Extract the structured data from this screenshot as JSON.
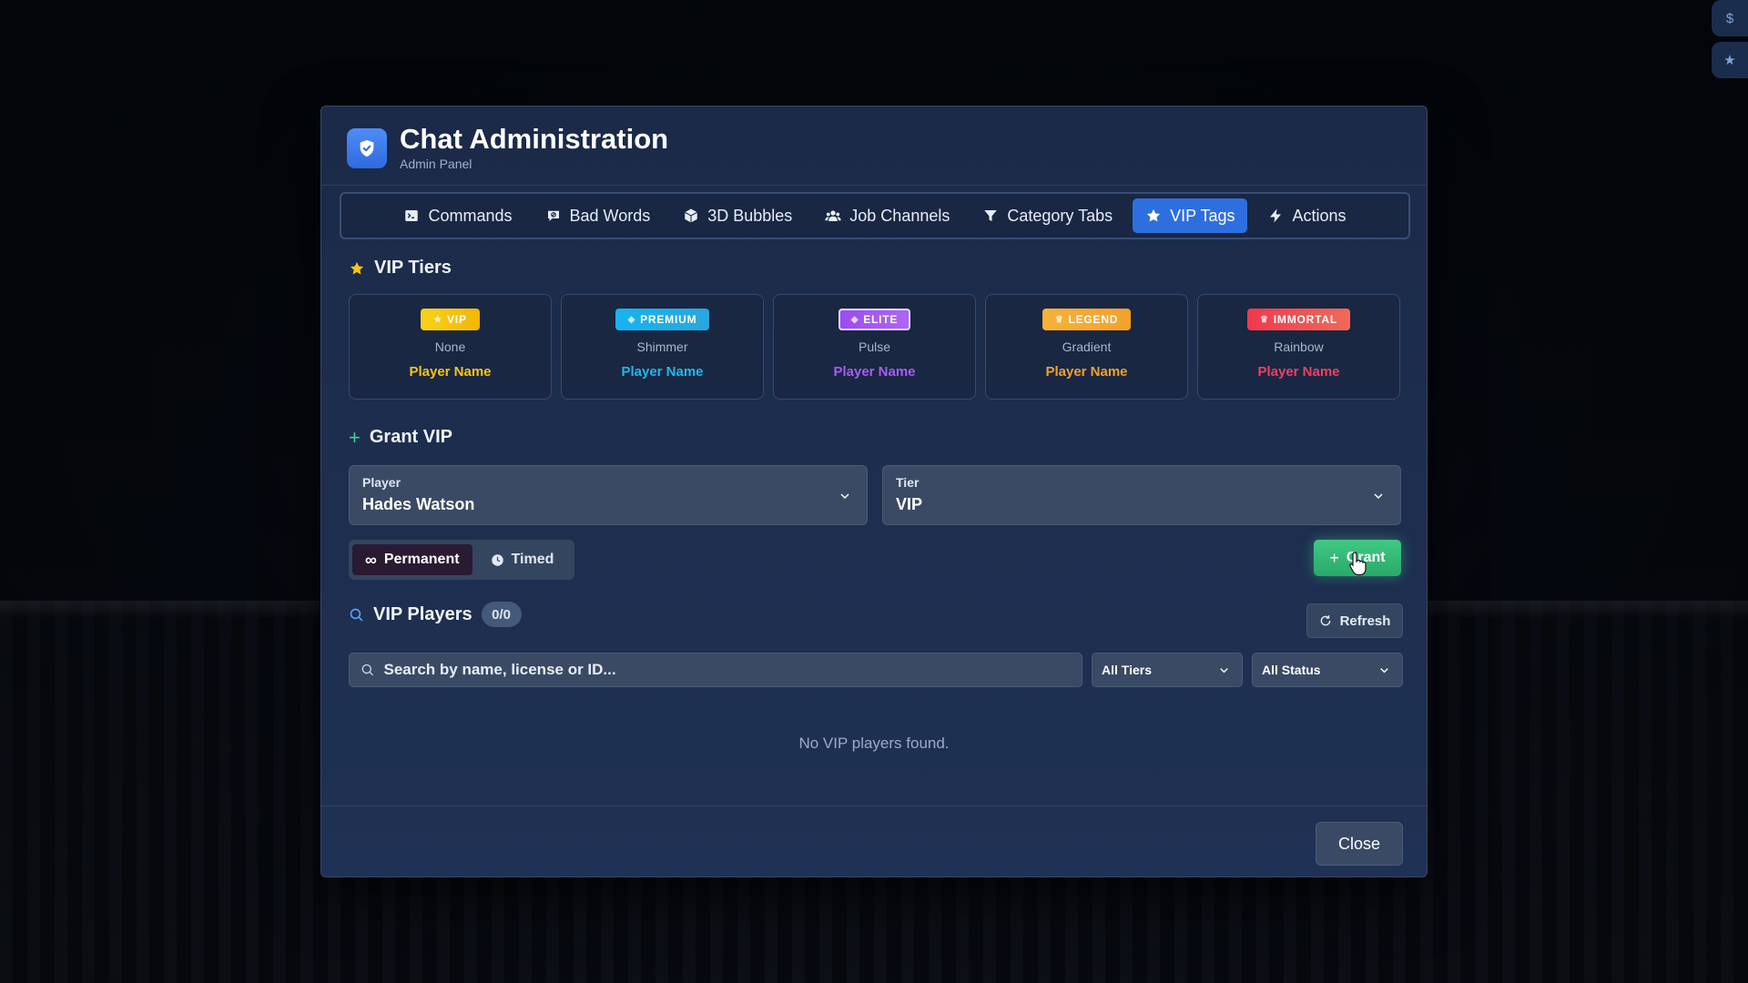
{
  "header": {
    "title": "Chat Administration",
    "subtitle": "Admin Panel"
  },
  "tabs": [
    {
      "label": "Commands",
      "icon": "terminal-icon"
    },
    {
      "label": "Bad Words",
      "icon": "message-block-icon"
    },
    {
      "label": "3D Bubbles",
      "icon": "cube-icon"
    },
    {
      "label": "Job Channels",
      "icon": "users-icon"
    },
    {
      "label": "Category Tabs",
      "icon": "filter-icon"
    },
    {
      "label": "VIP Tags",
      "icon": "star-icon",
      "active": true
    },
    {
      "label": "Actions",
      "icon": "bolt-icon"
    }
  ],
  "vip_tiers": {
    "title": "VIP Tiers",
    "tiers": [
      {
        "badge": "VIP",
        "effect": "None",
        "player": "Player Name",
        "color": "#f5c518"
      },
      {
        "badge": "PREMIUM",
        "effect": "Shimmer",
        "player": "Player Name",
        "color": "#22b8e8"
      },
      {
        "badge": "ELITE",
        "effect": "Pulse",
        "player": "Player Name",
        "color": "#a65cf0"
      },
      {
        "badge": "LEGEND",
        "effect": "Gradient",
        "player": "Player Name",
        "color": "#f0a030"
      },
      {
        "badge": "IMMORTAL",
        "effect": "Rainbow",
        "player": "Player Name",
        "color": "#ef3f63"
      }
    ]
  },
  "grant_vip": {
    "title": "Grant VIP",
    "player_label": "Player",
    "player_value": "Hades Watson",
    "tier_label": "Tier",
    "tier_value": "VIP",
    "mode_permanent": "Permanent",
    "mode_timed": "Timed",
    "grant_label": "Grant"
  },
  "vip_players": {
    "title": "VIP Players",
    "count": "0/0",
    "refresh_label": "Refresh",
    "search_placeholder": "Search by name, license or ID...",
    "tier_filter": "All Tiers",
    "status_filter": "All Status",
    "empty_text": "No VIP players found."
  },
  "footer": {
    "close_label": "Close"
  },
  "corner_buttons": [
    "$",
    "★"
  ],
  "colors": {
    "accent": "#2e6fe0",
    "grant": "#35b977",
    "panel": "#1d2d4d"
  }
}
